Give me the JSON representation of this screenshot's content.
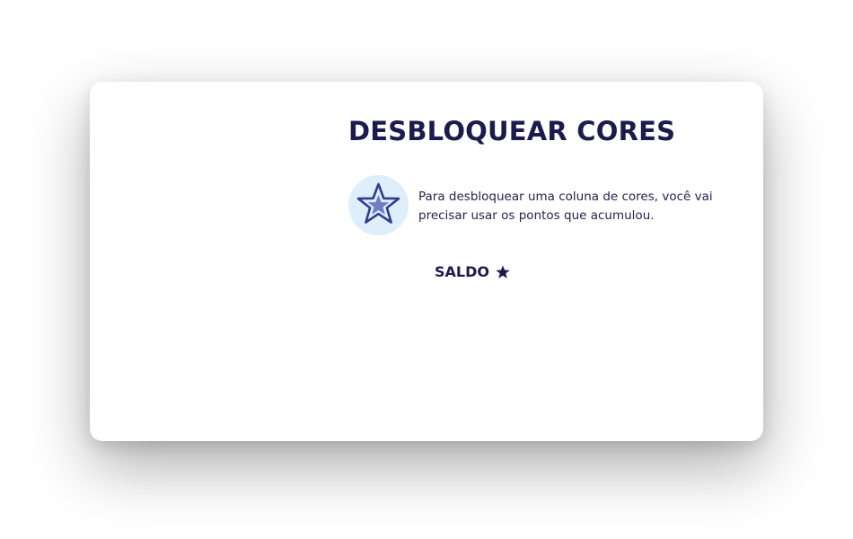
{
  "dialog": {
    "title": "DESBLOQUEAR CORES",
    "info_icon": "star-outline-icon",
    "info_text": "Para desbloquear uma coluna de cores, você vai precisar usar os pontos que acumulou.",
    "balance_label": "SALDO",
    "balance_icon": "star-icon"
  },
  "colors": {
    "title": "#1b1c4d",
    "badge_bg": "#deeefa",
    "star_stroke": "#2f3d8f",
    "star_fill": "#6f7ec4"
  }
}
